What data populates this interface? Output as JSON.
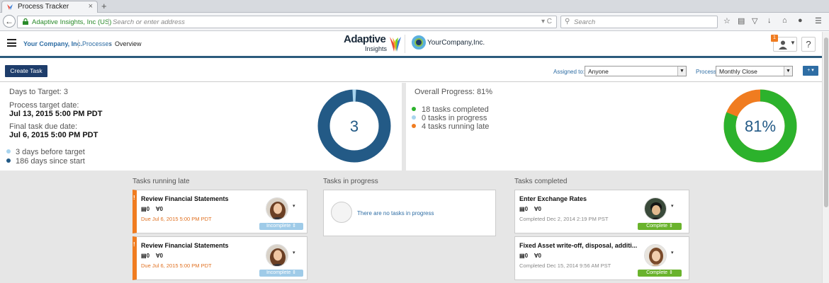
{
  "browser": {
    "tab_title": "Process Tracker",
    "tab_close": "×",
    "new_tab": "+",
    "back": "←",
    "site_identity": "Adaptive Insights, Inc (US)",
    "url_placeholder": "Search or enter address",
    "url_buttons": "▾ C",
    "search_placeholder": "Search",
    "toolbar_icons": [
      "star-icon",
      "reading-list-icon",
      "pocket-icon",
      "download-icon",
      "home-icon",
      "chat-icon",
      "menu-icon"
    ]
  },
  "header": {
    "breadcrumb_company": "Your Company, Inc.",
    "breadcrumb_processes": "Processes",
    "breadcrumb_arrow": "›",
    "breadcrumb_current": "Overview",
    "logo_adaptive": "Adaptive",
    "logo_insights": "Insights",
    "logo_yourcompany": "YourCompany,Inc.",
    "notification_count": "1",
    "help_label": "?"
  },
  "toolbar": {
    "create_task": "Create Task",
    "assigned_label": "Assigned to:",
    "assigned_value": "Anyone",
    "process_label": "Process:",
    "process_value": "Monthly Close",
    "plus_label": "+ ▾"
  },
  "days_panel": {
    "days_to_target": "Days to Target: 3",
    "process_target_label": "Process target date:",
    "process_target_value": "Jul 13, 2015 5:00 PM PDT",
    "final_task_label": "Final task due date:",
    "final_task_value": "Jul 6, 2015 5:00 PM PDT",
    "legend_before": "3 days before target",
    "legend_since": "186 days since start",
    "ring_value": "3",
    "ring_before_fraction": 0.016,
    "color_before": "#a8d4ee",
    "color_since": "#235a86"
  },
  "progress_panel": {
    "overall": "Overall Progress: 81%",
    "completed": "18 tasks completed",
    "in_progress": "0 tasks in progress",
    "late": "4 tasks running late",
    "ring_value": "81%",
    "completed_fraction": 0.81,
    "late_fraction": 0.19,
    "color_completed": "#2cb22c",
    "color_in_progress": "#a8d4ee",
    "color_late": "#f07c20"
  },
  "columns": {
    "late_title": "Tasks running late",
    "progress_title": "Tasks in progress",
    "completed_title": "Tasks completed",
    "empty_text": "There are no tasks in progress"
  },
  "late_tasks": [
    {
      "bang": "!",
      "title": "Review Financial Statements",
      "docs": "0",
      "attachments": "0",
      "due": "Due Jul 6, 2015 5:00 PM PDT",
      "status": "Incomplete ⇕",
      "caret": "▾"
    },
    {
      "bang": "!",
      "title": "Review Financial Statements",
      "docs": "0",
      "attachments": "0",
      "due": "Due Jul 6, 2015 5:00 PM PDT",
      "status": "Incomplete ⇕",
      "caret": "▾"
    }
  ],
  "completed_tasks": [
    {
      "title": "Enter Exchange Rates",
      "docs": "0",
      "attachments": "0",
      "completed": "Completed Dec 2, 2014 2:19 PM PST",
      "status": "Complete ⇕",
      "caret": "▾"
    },
    {
      "title": "Fixed Asset write-off, disposal, additi...",
      "docs": "0",
      "attachments": "0",
      "completed": "Completed Dec 15, 2014 9:56 AM PST",
      "status": "Complete ⇕",
      "caret": "▾"
    }
  ]
}
